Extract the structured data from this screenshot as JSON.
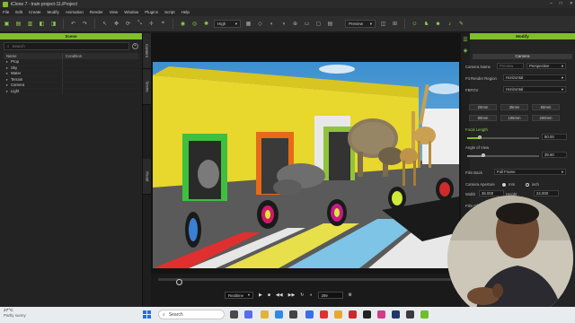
{
  "window": {
    "title": "iClone 7 - train project-11.iProject",
    "controls": [
      "–",
      "□",
      "✕"
    ]
  },
  "menu": [
    "File",
    "Edit",
    "Create",
    "Modify",
    "Animation",
    "Render",
    "View",
    "Window",
    "Plugins",
    "Script",
    "Help"
  ],
  "toolbar": {
    "quality_select": "High",
    "preview_select": "Preview"
  },
  "scene": {
    "header": "Scene",
    "search_placeholder": "Search",
    "columns": {
      "name": "Name",
      "condition": "Condition"
    },
    "items": [
      {
        "label": "Prop"
      },
      {
        "label": "Sky"
      },
      {
        "label": "Water"
      },
      {
        "label": "Terrain"
      },
      {
        "label": "Camera"
      },
      {
        "label": "Light"
      }
    ]
  },
  "side_tabs": [
    "Content",
    "Scene",
    "Visual"
  ],
  "modify": {
    "header": "Modify",
    "section": "Camera",
    "camera_name_label": "Camera Name",
    "camera_name_value": "Preview",
    "camera_type": "Perspective",
    "fit_region_label": "Fit Render Region",
    "fit_region_value": "Horizontal",
    "fov_label": "FBFOV",
    "fov_value": "Horizontal",
    "lens_buttons": [
      "20mm",
      "35mm",
      "50mm",
      "80mm",
      "105mm",
      "200mm"
    ],
    "focal_length_label": "Focal Length",
    "focal_length_value": "50.00",
    "focal_length_level": 0.18,
    "angle_label": "Angle of View",
    "angle_value": "39.60",
    "angle_level": 0.22,
    "film_back_label": "Film Back",
    "film_back_value": "Full Frame",
    "aperture_label": "Camera Aperture",
    "aperture_mm": "mm",
    "aperture_inch": "inch",
    "width_label": "Width",
    "width_value": "36.000",
    "height_label": "Height",
    "height_value": "24.000",
    "film_offset_label": "Film Of"
  },
  "timeline": {
    "mode": "Realtime",
    "frame": "289",
    "progress": 0.06
  },
  "taskbar": {
    "temperature": "27°C",
    "weather": "Partly sunny",
    "search": "Search"
  },
  "colors": {
    "accent": "#7fbf2a",
    "panel": "#242424",
    "sky": "#4ea3d8"
  }
}
